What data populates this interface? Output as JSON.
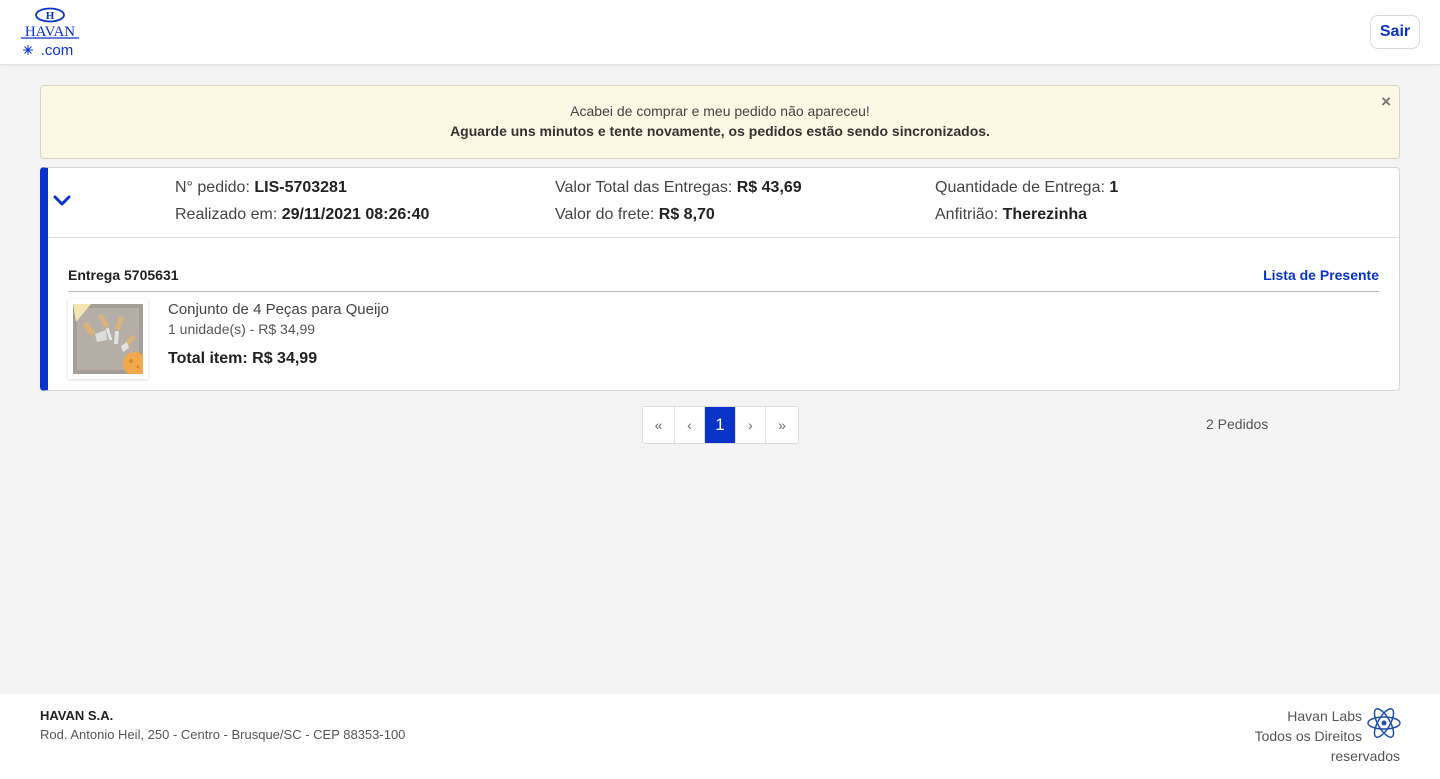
{
  "header": {
    "logo_letter": "H",
    "logo_text": "HAVAN",
    "logo_domain": ".com",
    "logout_label": "Sair"
  },
  "alert": {
    "line1": "Acabei de comprar e meu pedido não apareceu!",
    "line2": "Aguarde uns minutos e tente novamente, os pedidos estão sendo sincronizados.",
    "close_glyph": "×"
  },
  "order": {
    "number_label": "N° pedido:",
    "number_value": "LIS-5703281",
    "date_label": "Realizado em:",
    "date_value": "29/11/2021 08:26:40",
    "total_label": "Valor Total das Entregas:",
    "total_value": "R$ 43,69",
    "shipping_label": "Valor do frete:",
    "shipping_value": "R$ 8,70",
    "quantity_label": "Quantidade de Entrega:",
    "quantity_value": "1",
    "host_label": "Anfitrião:",
    "host_value": "Therezinha",
    "delivery": {
      "title": "Entrega 5705631",
      "gift_list_link": "Lista de Presente",
      "items": [
        {
          "name": "Conjunto de 4 Peças para Queijo",
          "quantity_price": "1 unidade(s) - R$ 34,99",
          "total": "Total item: R$ 34,99"
        }
      ]
    }
  },
  "pagination": {
    "first": "«",
    "prev": "‹",
    "current": "1",
    "next": "›",
    "last": "»",
    "count": "2 Pedidos"
  },
  "footer": {
    "company": "HAVAN S.A.",
    "address": "Rod. Antonio Heil, 250 - Centro - Brusque/SC - CEP 88353-100",
    "labs": "Havan Labs",
    "rights_line1": "Todos os Direitos",
    "rights_line2": "reservados"
  },
  "colors": {
    "brand_blue": "#0a33c9",
    "alert_bg": "#fcf8e3",
    "page_bg": "#f4f4f4"
  },
  "icons": {
    "expand": "chevron-down-icon",
    "labs": "atom-icon",
    "alert_close": "close-icon"
  }
}
